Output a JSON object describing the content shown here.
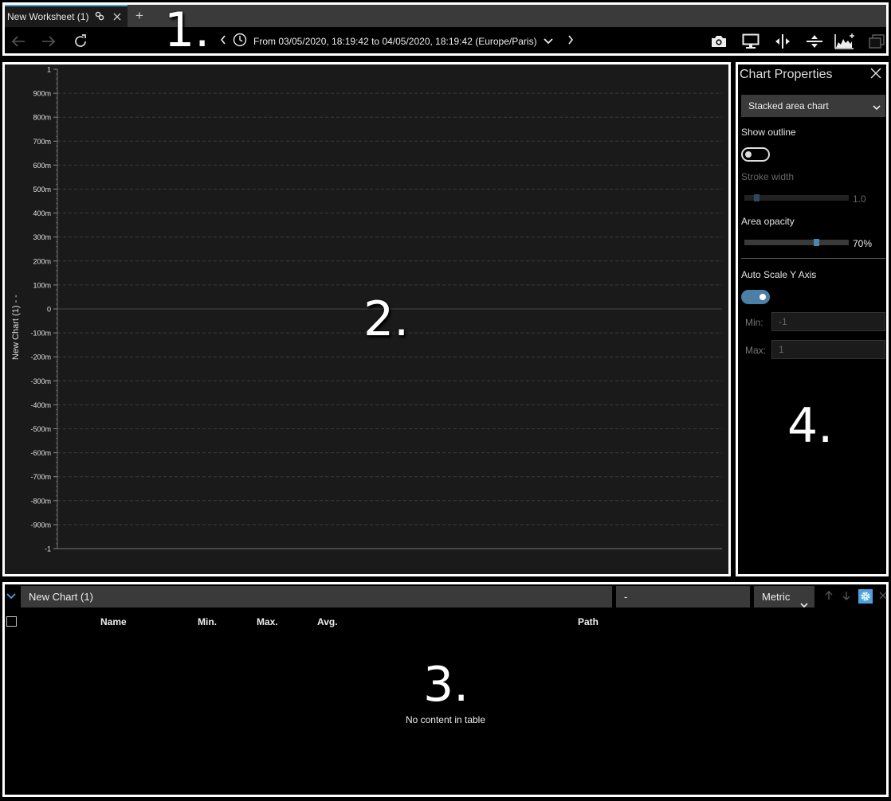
{
  "tabs": {
    "active_label": "New Worksheet (1)",
    "add_label": "+"
  },
  "toolbar": {
    "time_range": "From 03/05/2020, 18:19:42 to 04/05/2020, 18:19:42 (Europe/Paris)"
  },
  "chart": {
    "y_axis_title": "New Chart (1) - -",
    "ylim": [
      -1,
      1
    ],
    "ticks": [
      "1",
      "900m",
      "800m",
      "700m",
      "600m",
      "500m",
      "400m",
      "300m",
      "200m",
      "100m",
      "0",
      "-100m",
      "-200m",
      "-300m",
      "-400m",
      "-500m",
      "-600m",
      "-700m",
      "-800m",
      "-900m",
      "-1"
    ]
  },
  "properties": {
    "title": "Chart Properties",
    "chart_type": "Stacked area chart",
    "show_outline_label": "Show outline",
    "show_outline": false,
    "stroke_width_label": "Stroke width",
    "stroke_width_value": "1.0",
    "stroke_width_fraction": 0.1,
    "area_opacity_label": "Area opacity",
    "area_opacity_value": "70%",
    "area_opacity_fraction": 0.7,
    "auto_scale_label": "Auto Scale Y Axis",
    "auto_scale": true,
    "min_label": "Min:",
    "min_value": "-1",
    "max_label": "Max:",
    "max_value": "1"
  },
  "table": {
    "chart_name": "New Chart (1)",
    "unit": "-",
    "metric_label": "Metric",
    "columns": [
      "Name",
      "Min.",
      "Max.",
      "Avg.",
      "Path"
    ],
    "empty_message": "No content in table"
  },
  "annotations": [
    "1.",
    "2.",
    "3.",
    "4."
  ],
  "colors": {
    "accent": "#4aa3df",
    "toggle_on": "#4b7fa6",
    "chart_bg": "#1a1a1a",
    "panel_bg": "#000000"
  }
}
